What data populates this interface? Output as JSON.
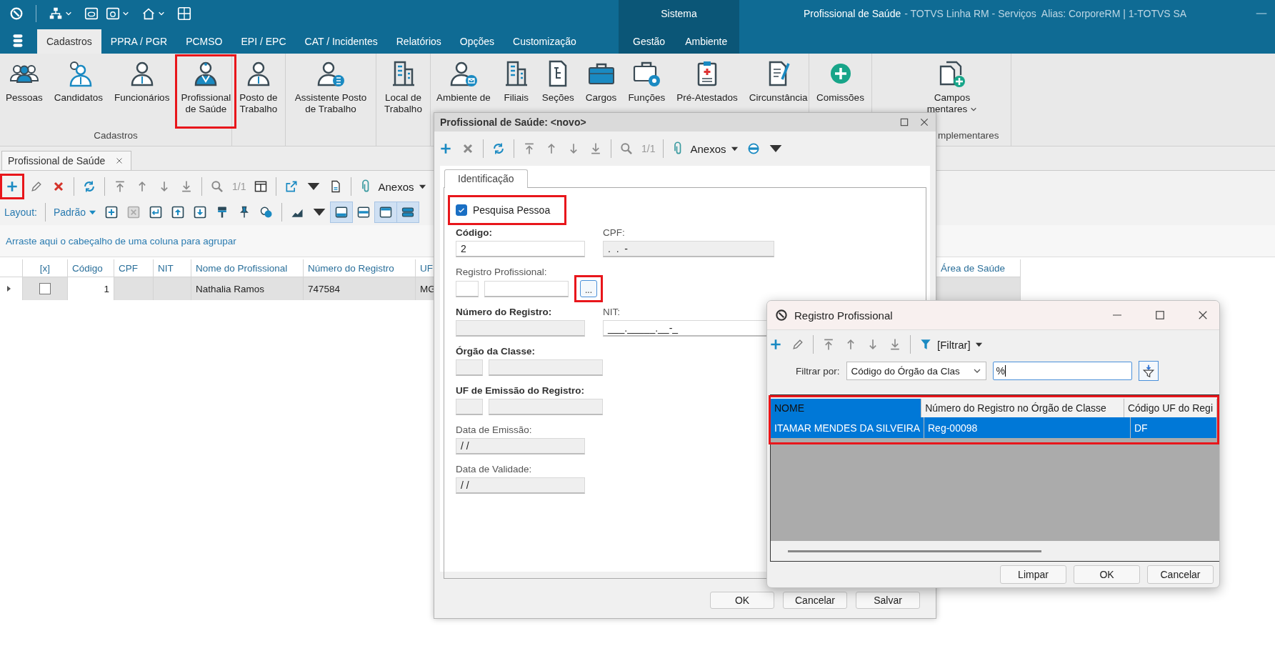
{
  "title_bar": {
    "context_group": "Sistema",
    "app_title": "Profissional de Saúde",
    "app_subtitle": "- TOTVS Linha RM - Serviços  Alias: CorporeRM | 1-TOTVS SA"
  },
  "menu_tabs": [
    {
      "label": "Cadastros",
      "selected": true
    },
    {
      "label": "PPRA / PGR",
      "selected": false
    },
    {
      "label": "PCMSO",
      "selected": false
    },
    {
      "label": "EPI / EPC",
      "selected": false
    },
    {
      "label": "CAT / Incidentes",
      "selected": false
    },
    {
      "label": "Relatórios",
      "selected": false
    },
    {
      "label": "Opções",
      "selected": false
    },
    {
      "label": "Customização",
      "selected": false
    }
  ],
  "context_tabs": [
    {
      "label": "Gestão",
      "selected": false
    },
    {
      "label": "Ambiente",
      "selected": false
    }
  ],
  "ribbon": {
    "groups": [
      {
        "label": "Cadastros",
        "items": [
          {
            "label": "Pessoas",
            "highlighted": false
          },
          {
            "label": "Candidatos",
            "highlighted": false
          },
          {
            "label": "Funcionários",
            "highlighted": false
          },
          {
            "label": "Profissional\nde Saúde",
            "highlighted": true
          }
        ]
      },
      {
        "items": [
          {
            "label": "Posto de\nTrabalho",
            "highlighted": false
          }
        ]
      },
      {
        "items": [
          {
            "label": "Assistente Posto\nde Trabalho",
            "highlighted": false
          }
        ]
      },
      {
        "items": [
          {
            "label": "Local de\nTrabalho",
            "highlighted": false
          }
        ]
      },
      {
        "items": [
          {
            "label": "Ambiente de",
            "highlighted": false
          },
          {
            "label": "Filiais",
            "highlighted": false
          },
          {
            "label": "Seções",
            "highlighted": false
          },
          {
            "label": "Cargos",
            "highlighted": false
          },
          {
            "label": "Funções",
            "highlighted": false
          },
          {
            "label": "Pré-Atestados",
            "highlighted": false
          },
          {
            "label": "Circunstância",
            "highlighted": false
          }
        ]
      },
      {
        "items": [
          {
            "label": "Comissões",
            "highlighted": false
          }
        ]
      },
      {
        "label": "mplementares",
        "items": [
          {
            "label": "Campos\nmentares",
            "highlighted": false,
            "has_menu": true
          }
        ]
      }
    ]
  },
  "document_tab": {
    "label": "Profissional de Saúde",
    "selected": true
  },
  "list_toolbar": {
    "add_highlighted": true,
    "counter": "1/1",
    "attachments": "Anexos",
    "layout_label": "Layout:",
    "layout_value": "Padrão",
    "layout_toggles": [
      {
        "selected": true
      },
      {
        "selected": false
      },
      {
        "selected": true
      },
      {
        "selected": true
      }
    ]
  },
  "group_hint": "Arraste aqui o cabeçalho de uma coluna para agrupar",
  "grid": {
    "columns": [
      "[x]",
      "Código",
      "CPF",
      "NIT",
      "Nome do Profissional",
      "Número do Registro",
      "UF",
      "Área de Saúde"
    ],
    "rows": [
      {
        "checked": false,
        "codigo": "1",
        "nome": "Nathalia Ramos",
        "registro": "747584",
        "uf": "MG"
      }
    ]
  },
  "form_dialog": {
    "title": "Profissional de Saúde: <novo>",
    "counter": "1/1",
    "attachments": "Anexos",
    "tab": {
      "label": "Identificação",
      "selected": true
    },
    "search_person": {
      "label": "Pesquisa Pessoa",
      "checked": true,
      "highlighted": true
    },
    "rows": [
      [
        {
          "label": "Código:",
          "required": true,
          "kind": "text",
          "value": "2",
          "disabled": false
        },
        {
          "label": "CPF:",
          "required": false,
          "kind": "text",
          "value": ".  .  -",
          "disabled": true
        }
      ],
      [
        {
          "label": "Registro Profissional:",
          "required": false,
          "kind": "lookup",
          "disabled": false,
          "button": "...",
          "highlighted": true
        }
      ],
      [
        {
          "label": "Número do Registro:",
          "required": true,
          "kind": "text",
          "disabled": true
        },
        {
          "label": "NIT:",
          "required": false,
          "kind": "text",
          "value": "___._____.__-_",
          "disabled": false
        }
      ],
      [
        {
          "label": "Órgão da Classe:",
          "required": true,
          "kind": "pair",
          "disabled": true
        }
      ],
      [
        {
          "label": "UF de Emissão do Registro:",
          "required": true,
          "kind": "pair",
          "disabled": true
        }
      ],
      [
        {
          "label": "Data de Emissão:",
          "required": false,
          "kind": "text",
          "value": "/ /",
          "disabled": true
        }
      ],
      [
        {
          "label": "Data de Validade:",
          "required": false,
          "kind": "text",
          "value": "/ /",
          "disabled": true
        }
      ]
    ],
    "buttons": [
      "OK",
      "Cancelar",
      "Salvar"
    ]
  },
  "lookup_dialog": {
    "title": "Registro Profissional",
    "filter_button": "[Filtrar]",
    "filter_label": "Filtrar por:",
    "filter_field": "Código do Órgão da Clas",
    "filter_value": "%",
    "columns": [
      {
        "label": "NOME",
        "selected": true
      },
      {
        "label": "Número do Registro no Órgão de Classe",
        "selected": false
      },
      {
        "label": "Código UF do Regi",
        "selected": false
      }
    ],
    "rows": [
      {
        "cells": [
          "ITAMAR MENDES DA SILVEIRA",
          "Reg-00098",
          "DF"
        ],
        "selected": true
      }
    ],
    "grid_highlighted": true,
    "buttons": [
      "Limpar",
      "OK",
      "Cancelar"
    ]
  }
}
